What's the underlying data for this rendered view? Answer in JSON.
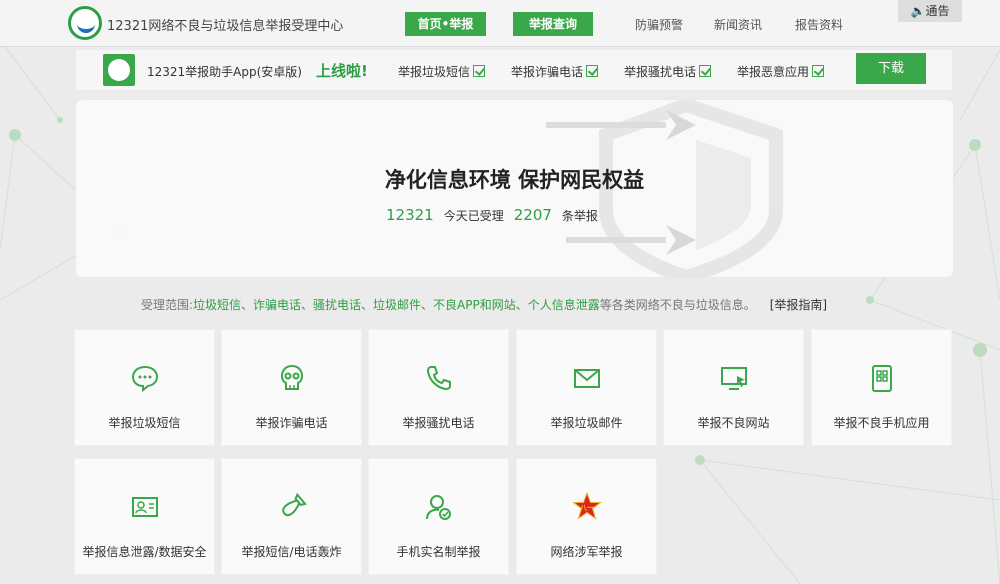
{
  "header": {
    "site_title": "12321网络不良与垃圾信息举报受理中心",
    "nav_buttons": [
      "首页•举报",
      "举报查询"
    ],
    "nav_links": [
      "防骗预警",
      "新闻资讯",
      "报告资料"
    ],
    "notice": "通告"
  },
  "appbar": {
    "label": "12321举报助手App(安卓版)",
    "online": "上线啦!",
    "features": [
      "举报垃圾短信",
      "举报诈骗电话",
      "举报骚扰电话",
      "举报恶意应用"
    ],
    "download": "下载"
  },
  "hero": {
    "title": "净化信息环境 保护网民权益",
    "number": "12321",
    "today_text": "今天已受理",
    "count": "2207",
    "count_suffix": "条举报"
  },
  "scope": {
    "prefix": "受理范围:",
    "items": "垃圾短信、诈骗电话、骚扰电话、垃圾邮件、不良APP和网站、个人信息泄露",
    "suffix": "等各类网络不良与垃圾信息。",
    "guide": "[举报指南]"
  },
  "cards": [
    {
      "label": "举报垃圾短信",
      "icon": "message-bubble-icon"
    },
    {
      "label": "举报诈骗电话",
      "icon": "skull-icon"
    },
    {
      "label": "举报骚扰电话",
      "icon": "phone-icon"
    },
    {
      "label": "举报垃圾邮件",
      "icon": "mail-icon"
    },
    {
      "label": "举报不良网站",
      "icon": "monitor-cursor-icon"
    },
    {
      "label": "举报不良手机应用",
      "icon": "phone-apps-icon"
    },
    {
      "label": "举报信息泄露/数据安全",
      "icon": "id-card-icon"
    },
    {
      "label": "举报短信/电话轰炸",
      "icon": "bomb-icon"
    },
    {
      "label": "手机实名制举报",
      "icon": "user-check-icon"
    },
    {
      "label": "网络涉军举报",
      "icon": "army-star-icon"
    }
  ],
  "colors": {
    "accent": "#3aa84a",
    "text": "#333333",
    "background": "#ebebeb"
  }
}
